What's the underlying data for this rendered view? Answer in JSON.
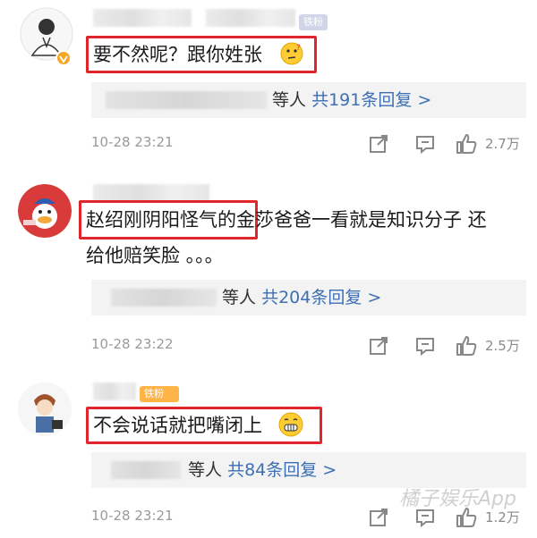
{
  "comments": [
    {
      "badge": "铁粉",
      "text_line1": "要不然呢？跟你姓张",
      "text_line2": "",
      "emoji": "thinking-face",
      "reply_who": "等人",
      "reply_count": "共191条回复 >",
      "time": "10-28 23:21",
      "likes": "2.7万"
    },
    {
      "badge": "",
      "text_highlight": "赵绍刚阴阳怪气的",
      "text_rest": "金莎爸爸一看就是知识分子 还",
      "text_line2": "给他赔笑脸 。。。",
      "reply_who": "等人",
      "reply_count": "共204条回复 >",
      "time": "10-28 23:22",
      "likes": "2.5万"
    },
    {
      "badge": "铁粉",
      "text_line1": "不会说话就把嘴闭上",
      "emoji": "grinning-face",
      "reply_who": "等人",
      "reply_count": "共84条回复 >",
      "time": "10-28 23:21",
      "likes": "1.2万"
    }
  ],
  "watermark": "橘子娱乐App",
  "colors": {
    "highlight": "#e0262b",
    "link": "#3c6fb4",
    "reply_bg": "#f3f3f3"
  }
}
